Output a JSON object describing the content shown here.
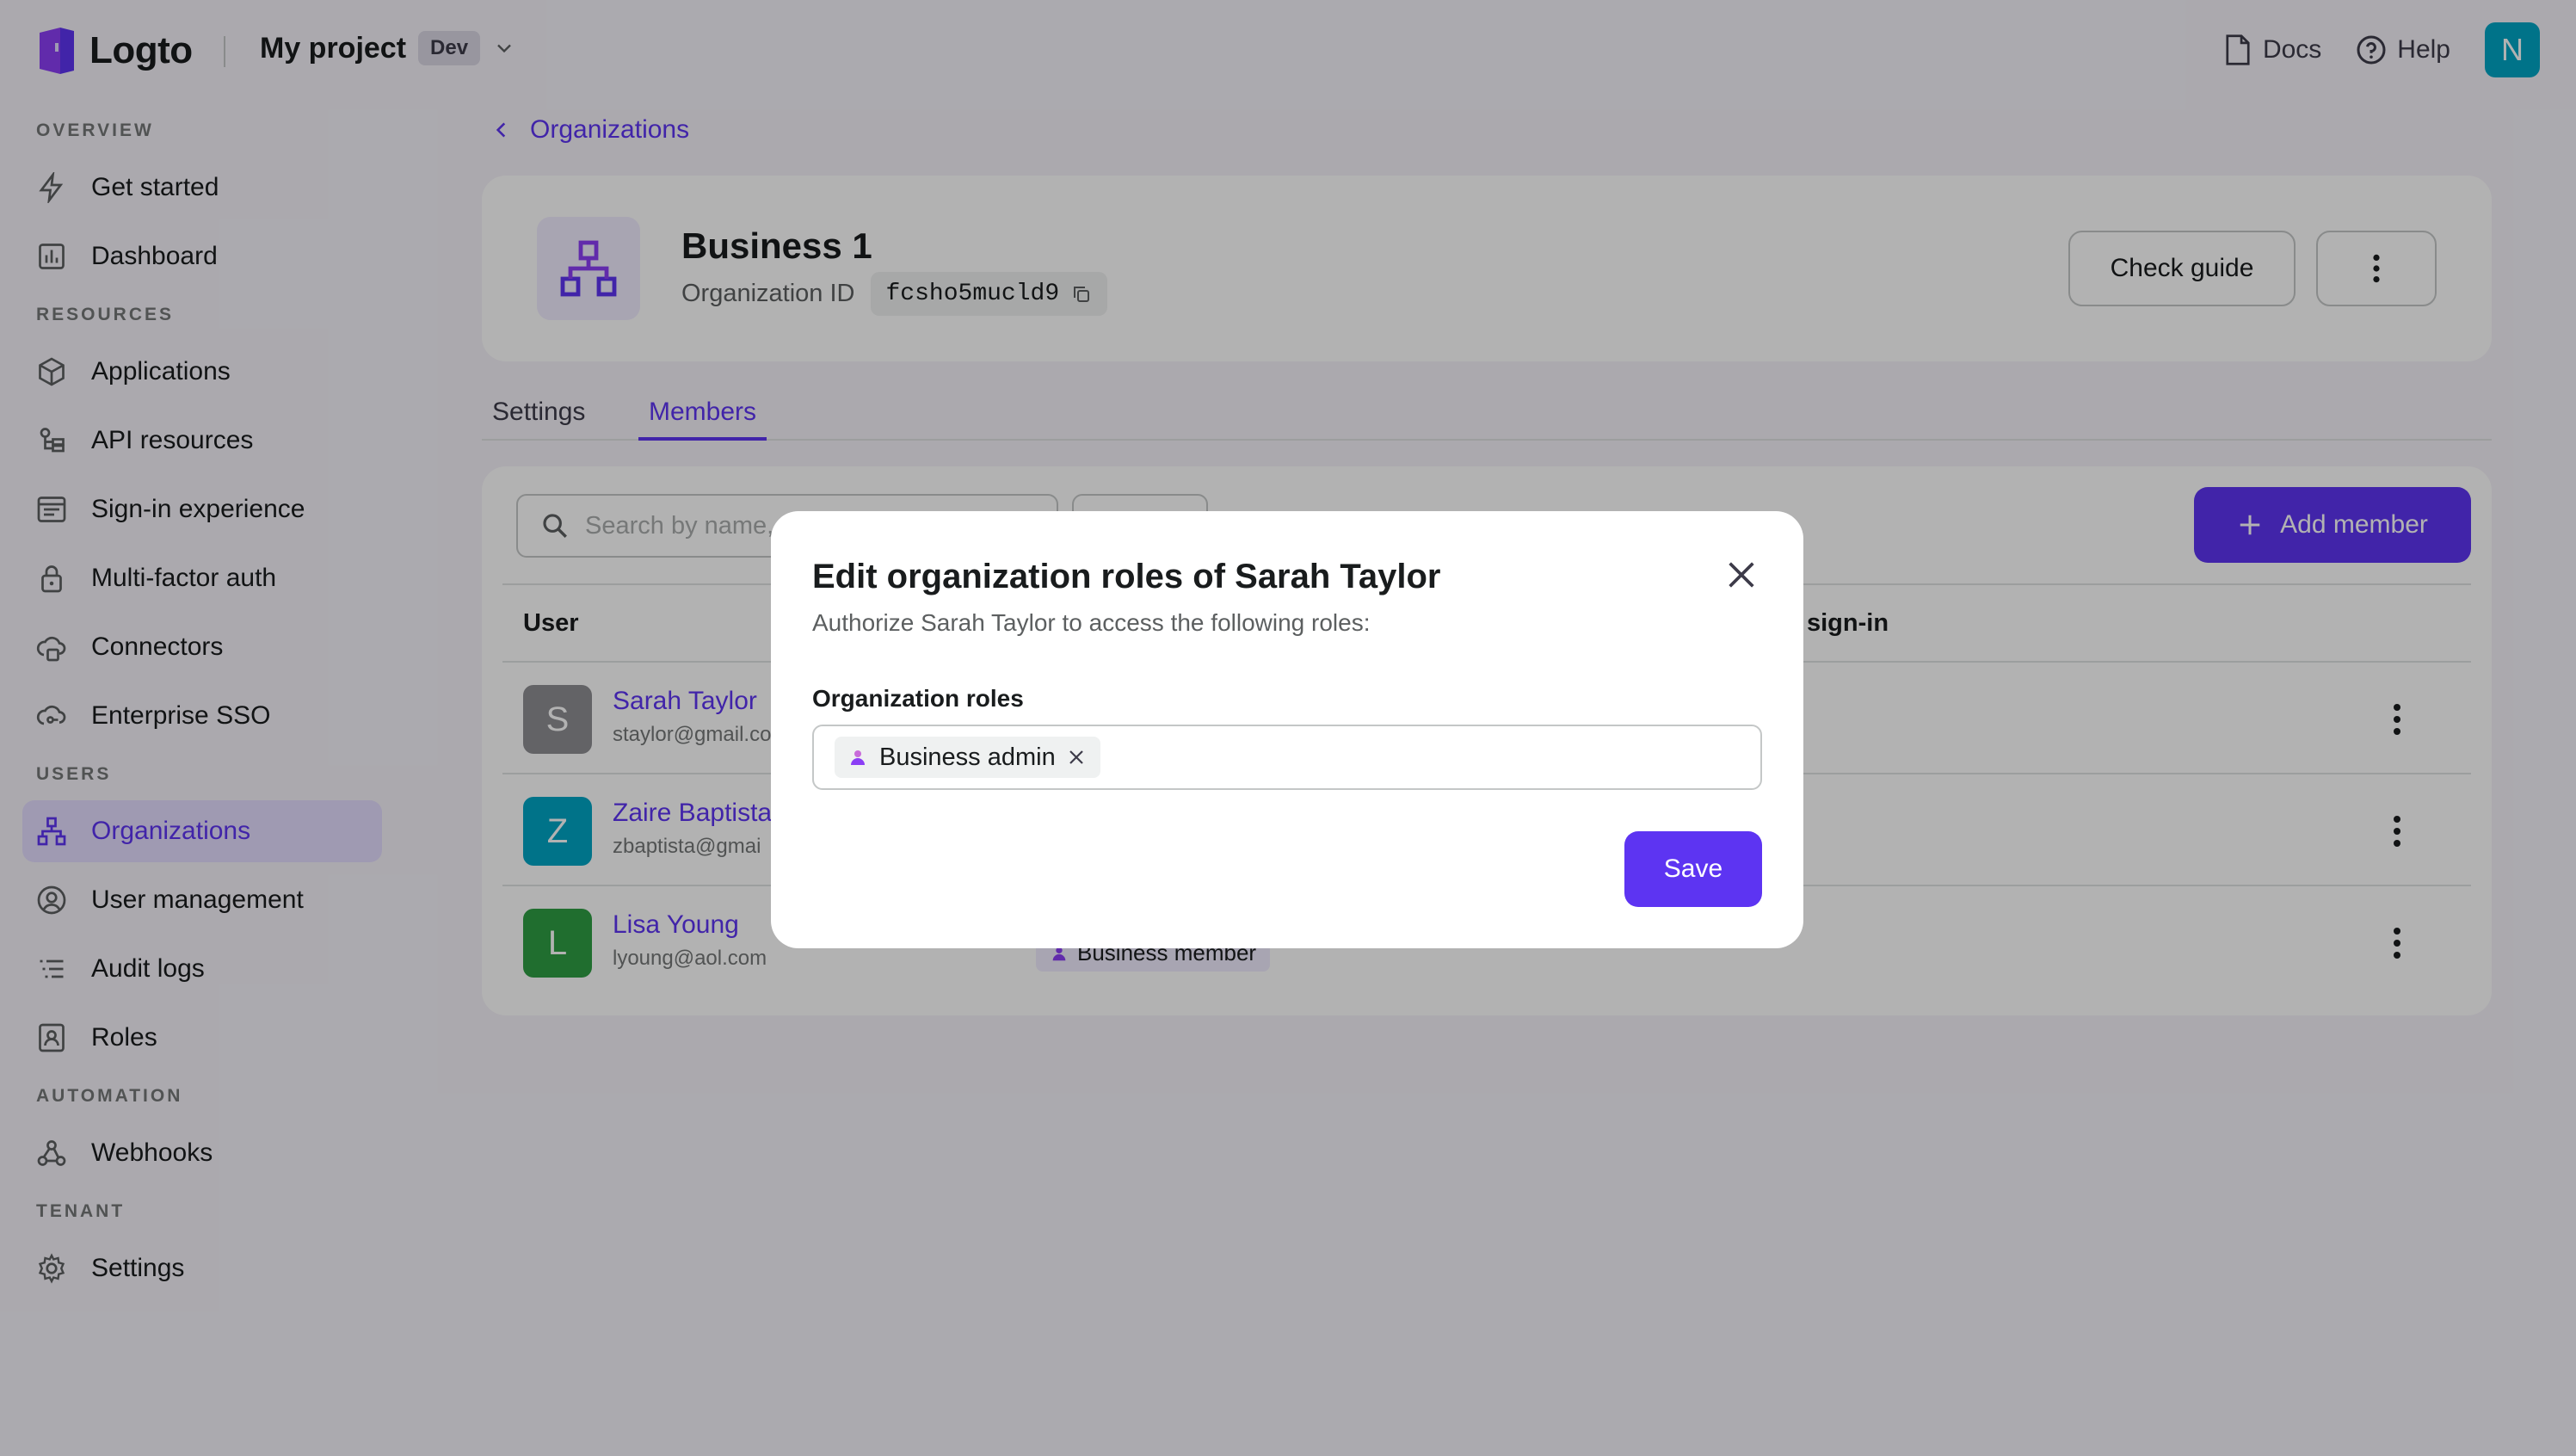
{
  "app": {
    "name": "Logto",
    "project": "My project",
    "env": "Dev"
  },
  "topbar": {
    "docs": "Docs",
    "help": "Help",
    "avatar": "N"
  },
  "sidebar": {
    "sections": [
      {
        "title": "OVERVIEW",
        "items": [
          {
            "label": "Get started",
            "icon": "bolt-icon"
          },
          {
            "label": "Dashboard",
            "icon": "chart-icon"
          }
        ]
      },
      {
        "title": "RESOURCES",
        "items": [
          {
            "label": "Applications",
            "icon": "cube-icon"
          },
          {
            "label": "API resources",
            "icon": "api-icon"
          },
          {
            "label": "Sign-in experience",
            "icon": "layout-icon"
          },
          {
            "label": "Multi-factor auth",
            "icon": "lock-icon"
          },
          {
            "label": "Connectors",
            "icon": "connector-icon"
          },
          {
            "label": "Enterprise SSO",
            "icon": "cloud-key-icon"
          }
        ]
      },
      {
        "title": "USERS",
        "items": [
          {
            "label": "Organizations",
            "icon": "org-icon",
            "active": true
          },
          {
            "label": "User management",
            "icon": "user-circle-icon"
          },
          {
            "label": "Audit logs",
            "icon": "list-icon"
          },
          {
            "label": "Roles",
            "icon": "role-icon"
          }
        ]
      },
      {
        "title": "AUTOMATION",
        "items": [
          {
            "label": "Webhooks",
            "icon": "webhook-icon"
          }
        ]
      },
      {
        "title": "TENANT",
        "items": [
          {
            "label": "Settings",
            "icon": "gear-icon"
          }
        ]
      }
    ]
  },
  "breadcrumb": {
    "back": "Organizations"
  },
  "org": {
    "name": "Business 1",
    "id_label": "Organization ID",
    "id": "fcsho5mucld9",
    "check_guide": "Check guide"
  },
  "tabs": [
    {
      "label": "Settings"
    },
    {
      "label": "Members",
      "active": true
    }
  ],
  "members": {
    "search_placeholder": "Search by name,",
    "add_button": "Add member",
    "columns": {
      "user": "User",
      "last_signin": "sign-in"
    },
    "rows": [
      {
        "initial": "S",
        "name": "Sarah Taylor",
        "email": "staylor@gmail.co",
        "color": "#8e8e93"
      },
      {
        "initial": "Z",
        "name": "Zaire Baptista",
        "email": "zbaptista@gmai",
        "color": "#00a5c4"
      },
      {
        "initial": "L",
        "name": "Lisa Young",
        "email": "lyoung@aol.com",
        "color": "#2f9e44",
        "role": "Business member"
      }
    ]
  },
  "modal": {
    "title": "Edit organization roles of Sarah Taylor",
    "subtitle": "Authorize Sarah Taylor to access the following roles:",
    "field_label": "Organization roles",
    "selected_role": "Business admin",
    "save": "Save"
  },
  "colors": {
    "accent": "#5d34f2",
    "accent_light": "#e4ddff"
  }
}
